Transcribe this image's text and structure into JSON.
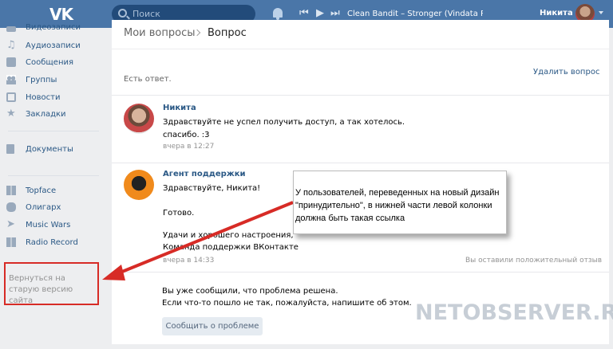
{
  "header": {
    "logo": "VK",
    "search_placeholder": "Поиск",
    "track": "Clean Bandit – Stronger (Vindata Re...",
    "user_name": "Никита"
  },
  "sidebar": {
    "items_top": [
      {
        "label": "Видеозаписи",
        "icon": "video-icon"
      },
      {
        "label": "Аудиозаписи",
        "icon": "music-icon"
      },
      {
        "label": "Сообщения",
        "icon": "message-icon"
      },
      {
        "label": "Группы",
        "icon": "groups-icon"
      },
      {
        "label": "Новости",
        "icon": "news-icon"
      },
      {
        "label": "Закладки",
        "icon": "star-icon"
      }
    ],
    "documents": "Документы",
    "apps": [
      {
        "label": "Topface",
        "icon": "app-icon"
      },
      {
        "label": "Олигарх",
        "icon": "coins-icon"
      },
      {
        "label": "Music Wars",
        "icon": "rocket-icon"
      },
      {
        "label": "Radio Record",
        "icon": "radio-icon"
      }
    ],
    "back_link": "Вернуться на старую версию сайта"
  },
  "breadcrumb": {
    "parent": "Мои вопросы",
    "current": "Вопрос"
  },
  "question": {
    "status": "Есть ответ.",
    "delete": "Удалить вопрос"
  },
  "messages": [
    {
      "name": "Никита",
      "lines": [
        "Здравствуйте не успел получить доступ, а так хотелось.",
        "спасибо. :3"
      ],
      "time": "вчера в 12:27"
    },
    {
      "name": "Агент поддержки",
      "greeting": "Здравствуйте, Никита!",
      "done": "Готово.",
      "sign1": "Удачи и хорошего настроения,",
      "sign2": "Команда поддержки ВКонтакте",
      "time": "вчера в 14:33",
      "feedback": "Вы оставили положительный отзыв"
    }
  ],
  "resolved": {
    "line1": "Вы уже сообщили, что проблема решена.",
    "line2": "Если что-то пошло не так, пожалуйста, напишите об этом.",
    "button": "Сообщить о проблеме"
  },
  "callout": "У пользователей, переведенных на новый дизайн \"принудительно\", в нижней части левой колонки должна быть такая ссылка",
  "watermark": "NETOBSERVER.RU",
  "colors": {
    "header": "#4a76a8",
    "link": "#2a5885",
    "highlight": "#d72b26"
  }
}
